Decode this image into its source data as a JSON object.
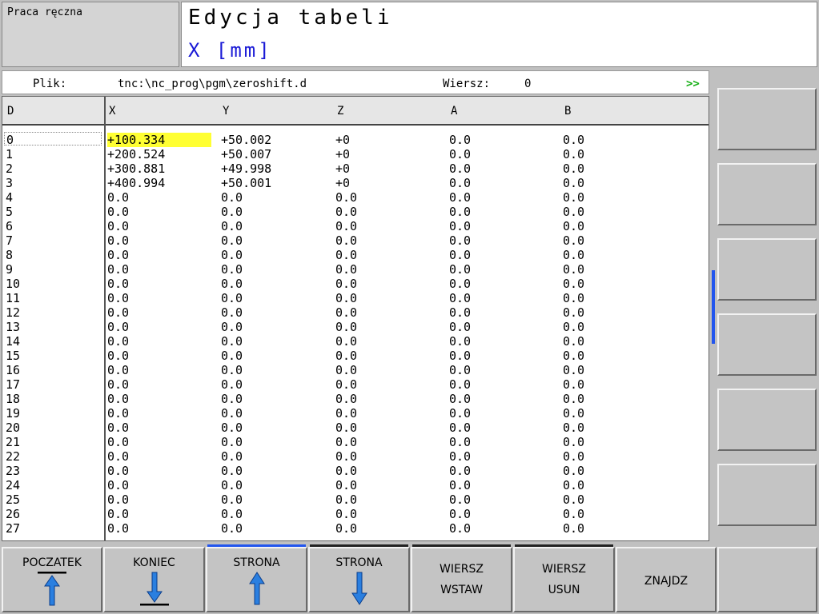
{
  "mode": {
    "label": "Praca ręczna"
  },
  "title": {
    "main": "Edycja tabeli",
    "sub": "X [mm]"
  },
  "file_bar": {
    "file_label": "Plik:",
    "file_path": "tnc:\\nc_prog\\pgm\\zeroshift.d",
    "row_label": "Wiersz:",
    "row_value": "0",
    "more_indicator": ">>"
  },
  "table": {
    "headers": [
      "D",
      "X",
      "Y",
      "Z",
      "A",
      "B"
    ],
    "rows": [
      [
        "0",
        "+100.334",
        "+50.002",
        "+0",
        "0.0",
        "0.0"
      ],
      [
        "1",
        "+200.524",
        "+50.007",
        "+0",
        "0.0",
        "0.0"
      ],
      [
        "2",
        "+300.881",
        "+49.998",
        "+0",
        "0.0",
        "0.0"
      ],
      [
        "3",
        "+400.994",
        "+50.001",
        "+0",
        "0.0",
        "0.0"
      ],
      [
        "4",
        "0.0",
        "0.0",
        "0.0",
        "0.0",
        "0.0"
      ],
      [
        "5",
        "0.0",
        "0.0",
        "0.0",
        "0.0",
        "0.0"
      ],
      [
        "6",
        "0.0",
        "0.0",
        "0.0",
        "0.0",
        "0.0"
      ],
      [
        "7",
        "0.0",
        "0.0",
        "0.0",
        "0.0",
        "0.0"
      ],
      [
        "8",
        "0.0",
        "0.0",
        "0.0",
        "0.0",
        "0.0"
      ],
      [
        "9",
        "0.0",
        "0.0",
        "0.0",
        "0.0",
        "0.0"
      ],
      [
        "10",
        "0.0",
        "0.0",
        "0.0",
        "0.0",
        "0.0"
      ],
      [
        "11",
        "0.0",
        "0.0",
        "0.0",
        "0.0",
        "0.0"
      ],
      [
        "12",
        "0.0",
        "0.0",
        "0.0",
        "0.0",
        "0.0"
      ],
      [
        "13",
        "0.0",
        "0.0",
        "0.0",
        "0.0",
        "0.0"
      ],
      [
        "14",
        "0.0",
        "0.0",
        "0.0",
        "0.0",
        "0.0"
      ],
      [
        "15",
        "0.0",
        "0.0",
        "0.0",
        "0.0",
        "0.0"
      ],
      [
        "16",
        "0.0",
        "0.0",
        "0.0",
        "0.0",
        "0.0"
      ],
      [
        "17",
        "0.0",
        "0.0",
        "0.0",
        "0.0",
        "0.0"
      ],
      [
        "18",
        "0.0",
        "0.0",
        "0.0",
        "0.0",
        "0.0"
      ],
      [
        "19",
        "0.0",
        "0.0",
        "0.0",
        "0.0",
        "0.0"
      ],
      [
        "20",
        "0.0",
        "0.0",
        "0.0",
        "0.0",
        "0.0"
      ],
      [
        "21",
        "0.0",
        "0.0",
        "0.0",
        "0.0",
        "0.0"
      ],
      [
        "22",
        "0.0",
        "0.0",
        "0.0",
        "0.0",
        "0.0"
      ],
      [
        "23",
        "0.0",
        "0.0",
        "0.0",
        "0.0",
        "0.0"
      ],
      [
        "24",
        "0.0",
        "0.0",
        "0.0",
        "0.0",
        "0.0"
      ],
      [
        "25",
        "0.0",
        "0.0",
        "0.0",
        "0.0",
        "0.0"
      ],
      [
        "26",
        "0.0",
        "0.0",
        "0.0",
        "0.0",
        "0.0"
      ],
      [
        "27",
        "0.0",
        "0.0",
        "0.0",
        "0.0",
        "0.0"
      ]
    ],
    "selected_row": 0,
    "highlight_color": "#ffff33"
  },
  "softkeys": [
    {
      "label": "POCZATEK",
      "icon": "arrow-up-to-bar-icon"
    },
    {
      "label": "KONIEC",
      "icon": "arrow-down-to-bar-icon"
    },
    {
      "label": "STRONA",
      "icon": "arrow-up-icon",
      "topbar": "#2255ee"
    },
    {
      "label": "STRONA",
      "icon": "arrow-down-icon",
      "topbar": "#222222"
    },
    {
      "label": "WIERSZ",
      "label2": "WSTAW",
      "topbar": "#222222"
    },
    {
      "label": "WIERSZ",
      "label2": "USUN",
      "topbar": "#222222"
    },
    {
      "label": "ZNAJDZ"
    },
    {
      "label": ""
    }
  ],
  "colors": {
    "accent_blue": "#1a1ad6",
    "arrow_blue": "#2a7fe0",
    "more_green": "#16b016"
  }
}
